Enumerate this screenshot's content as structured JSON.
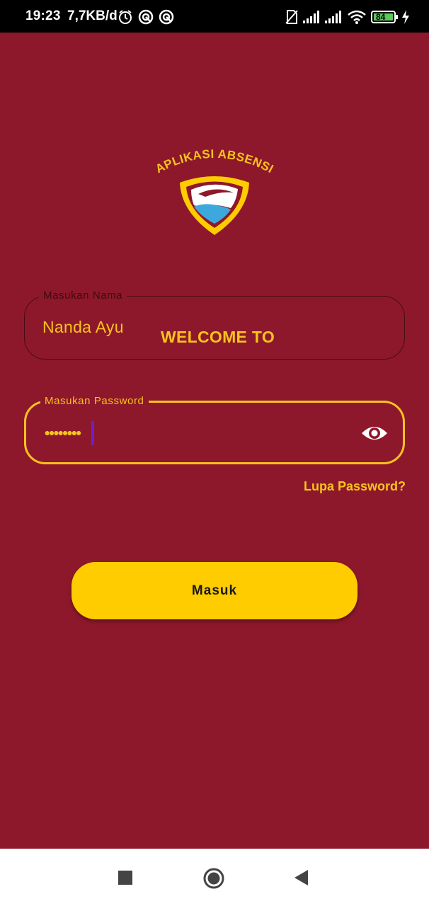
{
  "status_bar": {
    "time": "19:23",
    "net_speed": "7,7KB/d",
    "battery": "84",
    "icons": [
      "alarm-icon",
      "sync-icon",
      "sync-icon",
      "no-sim-icon",
      "signal-icon",
      "signal-icon",
      "wifi-icon",
      "battery-icon",
      "charging-icon"
    ]
  },
  "logo": {
    "text": "APLIKASI ABSENSI"
  },
  "welcome_text": "WELCOME TO",
  "name_field": {
    "label": "Masukan Nama",
    "value": "Nanda Ayu"
  },
  "password_field": {
    "label": "Masukan Password",
    "masked_value": "••••••••",
    "toggle_icon": "eye-icon"
  },
  "forgot_password": "Lupa Password?",
  "login_button": "Masuk",
  "nav_bar": {
    "buttons": [
      "recents-square-icon",
      "home-circle-icon",
      "back-triangle-icon"
    ]
  },
  "colors": {
    "background": "#8e182b",
    "accent": "#f7c31d",
    "button": "#ffcc00"
  }
}
